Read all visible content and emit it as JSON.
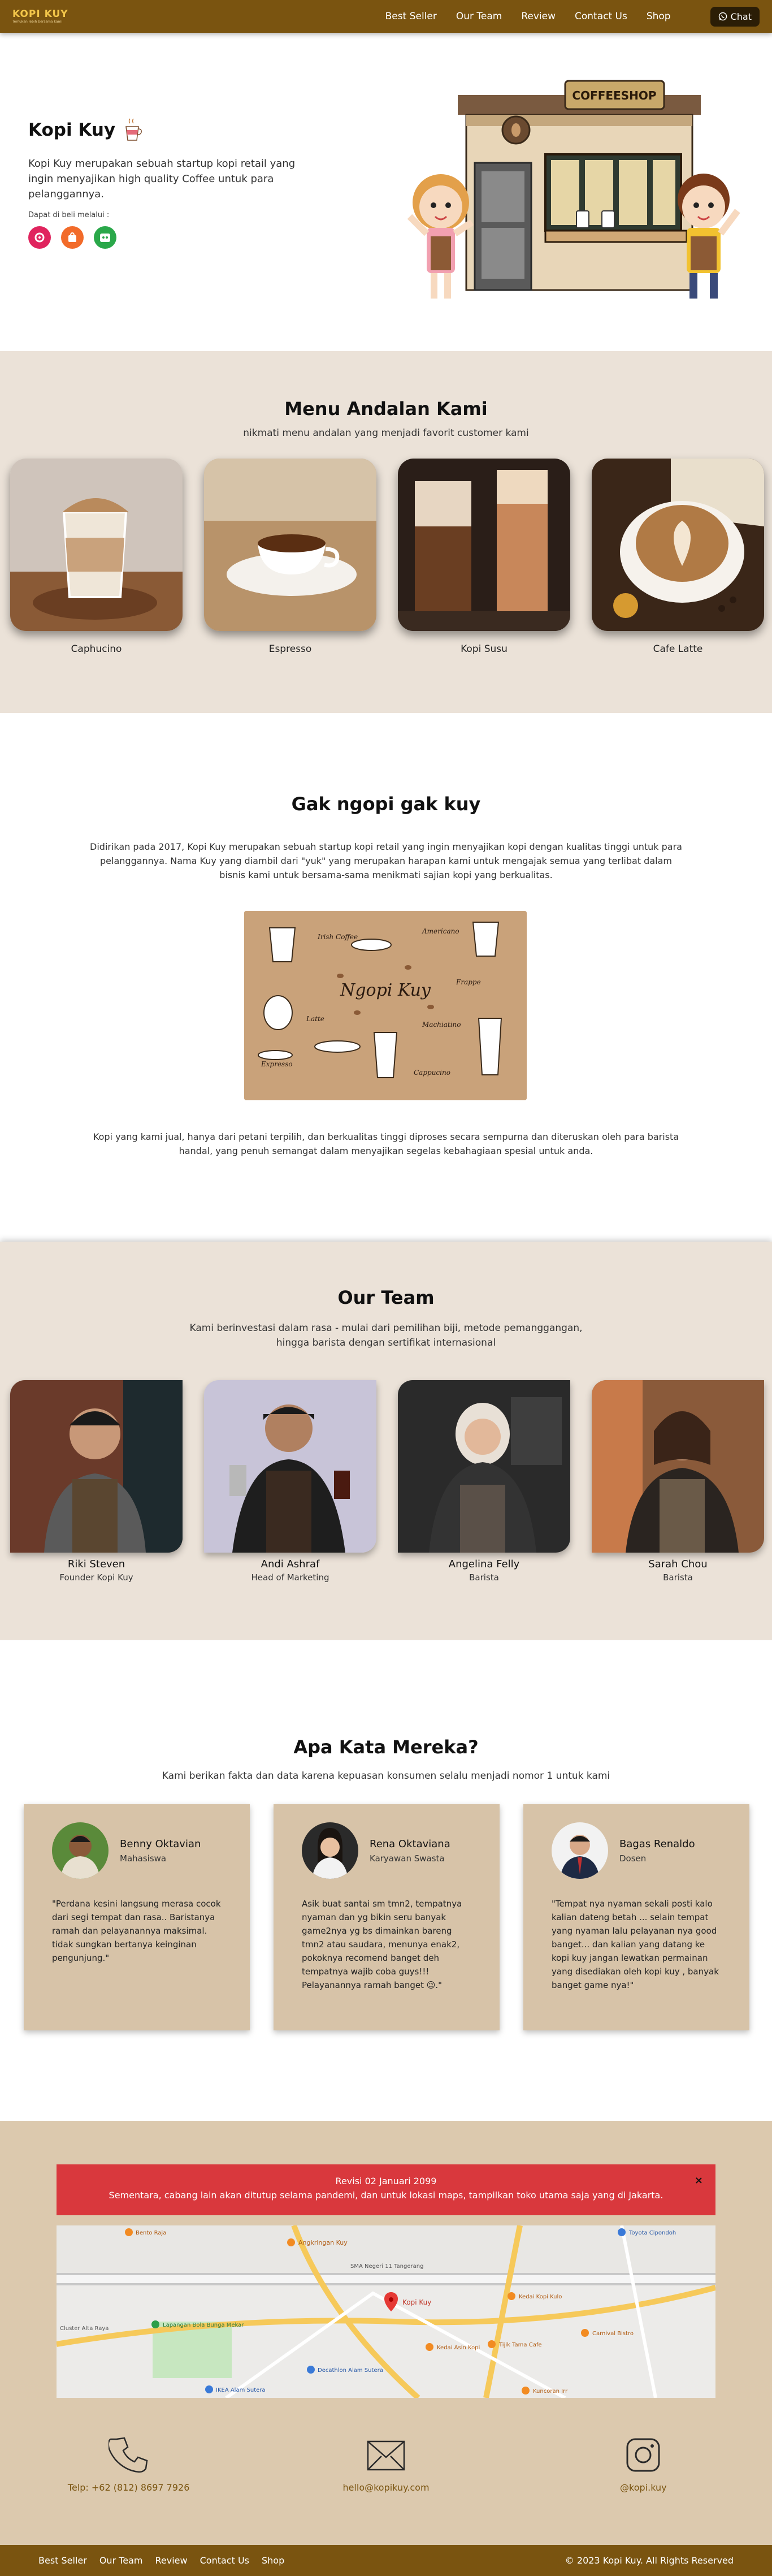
{
  "nav": {
    "brand": "KOPI KUY",
    "tagline": "Temukan lebih bersama kami",
    "links": [
      "Best Seller",
      "Our Team",
      "Review",
      "Contact Us",
      "Shop"
    ],
    "chat": "Chat"
  },
  "hero": {
    "title": "Kopi Kuy",
    "description": "Kopi Kuy merupakan sebuah startup kopi retail yang ingin menyajikan high quality Coffee untuk para pelanggannya.",
    "available": "Dapat di beli melalui :",
    "sign": "COFFEESHOP"
  },
  "menu": {
    "title": "Menu Andalan Kami",
    "subtitle": "nikmati menu andalan yang menjadi favorit customer kami",
    "items": [
      "Caphucino",
      "Espresso",
      "Kopi Susu",
      "Cafe Latte"
    ]
  },
  "about": {
    "title": "Gak ngopi gak kuy",
    "p1": "Didirikan pada 2017, Kopi Kuy merupakan sebuah startup kopi retail yang ingin menyajikan kopi dengan kualitas tinggi untuk para pelanggannya. Nama Kuy yang diambil dari \"yuk\" yang merupakan harapan kami untuk mengajak semua yang terlibat dalam bisnis kami untuk bersama-sama menikmati sajian kopi yang berkualitas.",
    "p2": "Kopi yang kami jual, hanya dari petani terpilih, dan berkualitas tinggi diproses secara sempurna dan diteruskan oleh para barista handal, yang penuh semangat dalam menyajikan segelas kebahagiaan spesial untuk anda.",
    "poster": {
      "title": "Ngopi Kuy",
      "labels": [
        "Irish Coffee",
        "Americano",
        "Frappe",
        "Latte",
        "Machiatino",
        "Expresso",
        "Cappucino"
      ]
    }
  },
  "team": {
    "title": "Our Team",
    "subtitle_1": "Kami berinvestasi dalam rasa - mulai dari pemilihan biji, metode pemanggangan,",
    "subtitle_2": "hingga barista dengan sertifikat internasional",
    "members": [
      {
        "name": "Riki Steven",
        "role": "Founder Kopi Kuy"
      },
      {
        "name": "Andi Ashraf",
        "role": "Head of Marketing"
      },
      {
        "name": "Angelina Felly",
        "role": "Barista"
      },
      {
        "name": "Sarah Chou",
        "role": "Barista"
      }
    ]
  },
  "reviews": {
    "title": "Apa Kata Mereka?",
    "subtitle": "Kami berikan fakta dan data karena kepuasan konsumen selalu menjadi nomor 1 untuk kami",
    "items": [
      {
        "name": "Benny Oktavian",
        "job": "Mahasiswa",
        "quote": "\"Perdana kesini langsung merasa cocok dari segi tempat dan rasa.. Baristanya ramah dan pelayanannya maksimal. tidak sungkan bertanya keinginan pengunjung.\""
      },
      {
        "name": "Rena Oktaviana",
        "job": "Karyawan Swasta",
        "quote": "Asik buat santai sm tmn2, tempatnya nyaman dan yg bikin seru banyak game2nya yg bs dimainkan bareng tmn2 atau saudara, menunya enak2, pokoknya recomend banget deh tempatnya wajib coba guys!!! Pelayanannya ramah banget 😉.\""
      },
      {
        "name": "Bagas Renaldo",
        "job": "Dosen",
        "quote": "\"Tempat nya nyaman sekali posti kalo kalian dateng betah ... selain tempat yang nyaman lalu pelayanan nya good banget... dan kalian yang datang ke kopi kuy jangan lewatkan permainan yang disediakan oleh kopi kuy , banyak banget game nya!\""
      }
    ]
  },
  "notice": {
    "title": "Revisi 02 Januari 2099",
    "text": "Sementara, cabang lain akan ditutup selama pandemi, dan untuk lokasi maps, tampilkan toko utama saja yang di Jakarta.",
    "close": "×"
  },
  "map": {
    "labels": [
      "Kopi Kuy",
      "Angkringan Kuy",
      "SMA Negeri 11 Tangerang",
      "Kedai Kopi Kulo",
      "Tijik Tama Cafe",
      "Kedai Asin Kopi",
      "Decathlon Alam Sutera",
      "IKEA Alam Sutera",
      "Lapangan Bola Bunga Mekar",
      "Toyota Cipondoh",
      "Bento Raja",
      "Cluster Alta Raya",
      "Carnival Bistro",
      "Kuncoran Irr"
    ]
  },
  "contact": {
    "phone": "Telp: +62 (812) 8697 7926",
    "email": "hello@kopikuy.com",
    "instagram": "@kopi.kuy"
  },
  "footer": {
    "links": [
      "Best Seller",
      "Our Team",
      "Review",
      "Contact Us",
      "Shop"
    ],
    "copyright": "© 2023 Kopi Kuy. All Rights Reserved"
  },
  "colors": {
    "brown": "#7a5410",
    "cream": "#ebe2d8",
    "card": "#d7c3a8",
    "alert": "#d9383d"
  }
}
